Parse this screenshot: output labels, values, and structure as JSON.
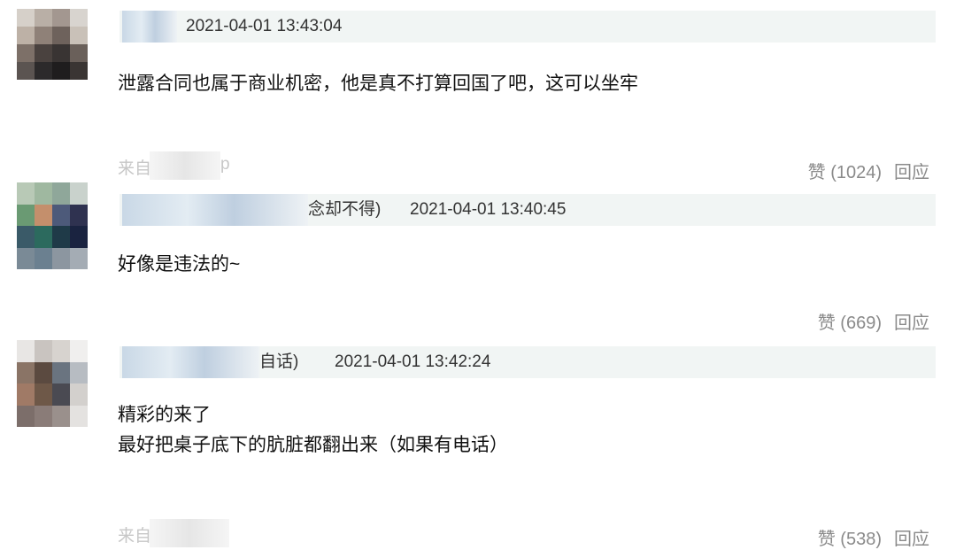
{
  "comments": [
    {
      "name_suffix": "",
      "timestamp": "2021-04-01 13:43:04",
      "lines": [
        "泄露合同也属于商业机密，他是真不打算回国了吧，这可以坐牢"
      ],
      "source_prefix": "来自",
      "source_suffix": "p",
      "like_label": "赞",
      "like_count": "(1024)",
      "reply_label": "回应",
      "avatar_colors": [
        "#d6d0c9",
        "#b9afa6",
        "#a39790",
        "#d8d4cf",
        "#bdb1a6",
        "#8f8178",
        "#6e625c",
        "#c9c1b8",
        "#7d7068",
        "#4a423f",
        "#393433",
        "#6a605a",
        "#5b5451",
        "#2c2a2b",
        "#1f1d1e",
        "#3a3533"
      ]
    },
    {
      "name_suffix": "念却不得)",
      "timestamp": "2021-04-01 13:40:45",
      "lines": [
        "好像是违法的~"
      ],
      "source_prefix": "",
      "source_suffix": "",
      "like_label": "赞",
      "like_count": "(669)",
      "reply_label": "回应",
      "avatar_colors": [
        "#b8c9b6",
        "#9fb8a0",
        "#8fa79a",
        "#c9d2cc",
        "#6a9a73",
        "#c48f6c",
        "#4d5a7a",
        "#2f3250",
        "#3a5a68",
        "#2c6a5e",
        "#1f3a48",
        "#1a2340",
        "#7a8a96",
        "#6b8090",
        "#8c96a0",
        "#a4acb4"
      ]
    },
    {
      "name_suffix": "自话)",
      "timestamp": "2021-04-01 13:42:24",
      "lines": [
        "精彩的来了",
        "最好把桌子底下的肮脏都翻出来（如果有电话）"
      ],
      "source_prefix": "来自",
      "source_suffix": "",
      "like_label": "赞",
      "like_count": "(538)",
      "reply_label": "回应",
      "avatar_colors": [
        "#e8e6e4",
        "#c9c4c0",
        "#d7d3cf",
        "#f0efee",
        "#8a7466",
        "#5b4a40",
        "#6a7480",
        "#b7bcc2",
        "#a07a66",
        "#6e5848",
        "#4a4a52",
        "#d3d0cd",
        "#7c6e6a",
        "#8a7c78",
        "#9a908c",
        "#e4e2e0"
      ]
    }
  ]
}
